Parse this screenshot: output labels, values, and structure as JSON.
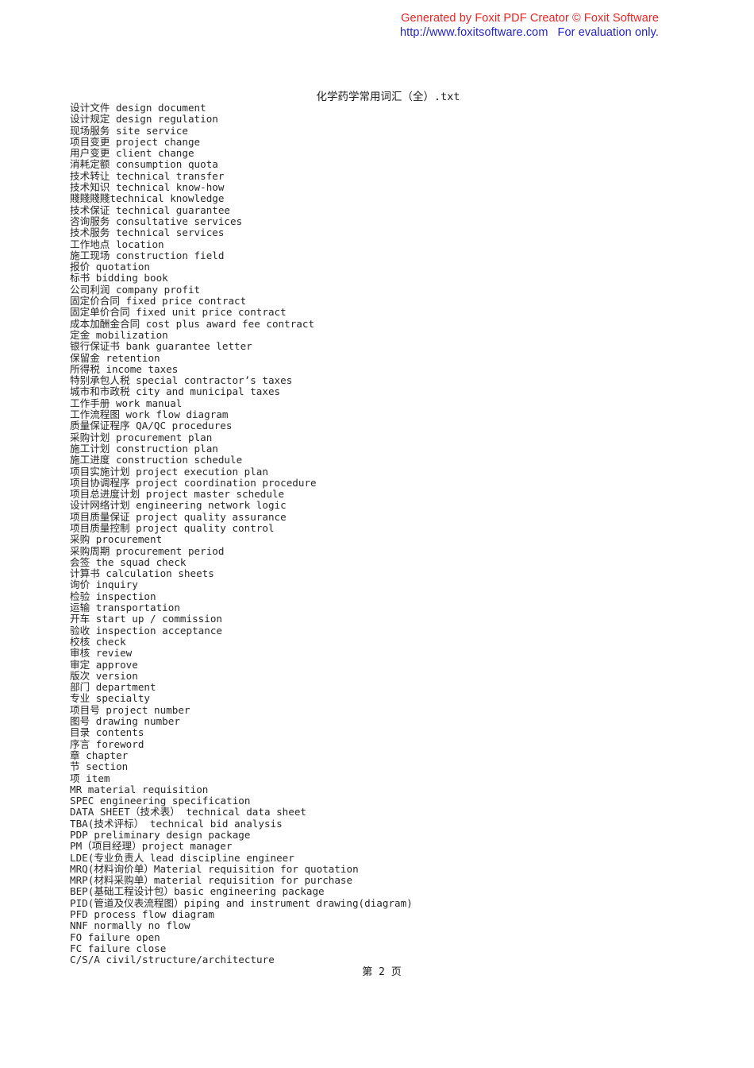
{
  "watermark": {
    "line1": "Generated by Foxit PDF Creator © Foxit Software",
    "url": "http://www.foxitsoftware.com",
    "evaluation_note": "For evaluation only.",
    "color_line1": "#ee2222",
    "color_line2": "#2222cc"
  },
  "document": {
    "title": "化学药学常用词汇（全）.txt",
    "footer": "第 2 页",
    "text_color": "#262626"
  },
  "lines": [
    "设计文件 design document",
    "设计规定 design regulation",
    "现场服务 site service",
    "项目变更 project change",
    "用户变更 client change",
    "消耗定额 consumption quota",
    "技术转让 technical transfer",
    "技术知识 technical know-how",
    "賤賤賤賤technical knowledge",
    "技术保证 technical guarantee",
    "咨询服务 consultative services",
    "技术服务 technical services",
    "工作地点 location",
    "施工现场 construction field",
    "报价 quotation",
    "标书 bidding book",
    "公司利润 company profit",
    "固定价合同 fixed price contract",
    "固定单价合同 fixed unit price contract",
    "成本加酬金合同 cost plus award fee contract",
    "定金 mobilization",
    "银行保证书 bank guarantee letter",
    "保留金 retention",
    "所得税 income taxes",
    "特别承包人税 special contractor’s taxes",
    "城市和市政税 city and municipal taxes",
    "工作手册 work manual",
    "工作流程图 work flow diagram",
    "质量保证程序 QA/QC procedures",
    "采购计划 procurement plan",
    "施工计划 construction plan",
    "施工进度 construction schedule",
    "项目实施计划 project execution plan",
    "项目协调程序 project coordination procedure",
    "项目总进度计划 project master schedule",
    "设计网络计划 engineering network logic",
    "项目质量保证 project quality assurance",
    "项目质量控制 project quality control",
    "采购 procurement",
    "采购周期 procurement period",
    "会签 the squad check",
    "计算书 calculation sheets",
    "询价 inquiry",
    "检验 inspection",
    "运输 transportation",
    "开车 start up / commission",
    "验收 inspection acceptance",
    "校核 check",
    "审核 review",
    "审定 approve",
    "版次 version",
    "部门 department",
    "专业 specialty",
    "项目号 project number",
    "图号 drawing number",
    "目录 contents",
    "序言 foreword",
    "章 chapter",
    "节 section",
    "项 item",
    "MR material requisition",
    "SPEC engineering specification",
    "DATA SHEET（技术表） technical data sheet",
    "TBA(技术评标） technical bid analysis",
    "PDP preliminary design package",
    "PM（项目经理）project manager",
    "LDE(专业负责人 lead discipline engineer",
    "MRQ(材料询价单）Material requisition for quotation",
    "MRP(材料采购单）material requisition for purchase",
    "BEP(基础工程设计包）basic engineering package",
    "PID(管道及仪表流程图）piping and instrument drawing(diagram)",
    "PFD process flow diagram",
    "NNF normally no flow",
    "FO failure open",
    "FC failure close",
    "C/S/A civil/structure/architecture"
  ]
}
